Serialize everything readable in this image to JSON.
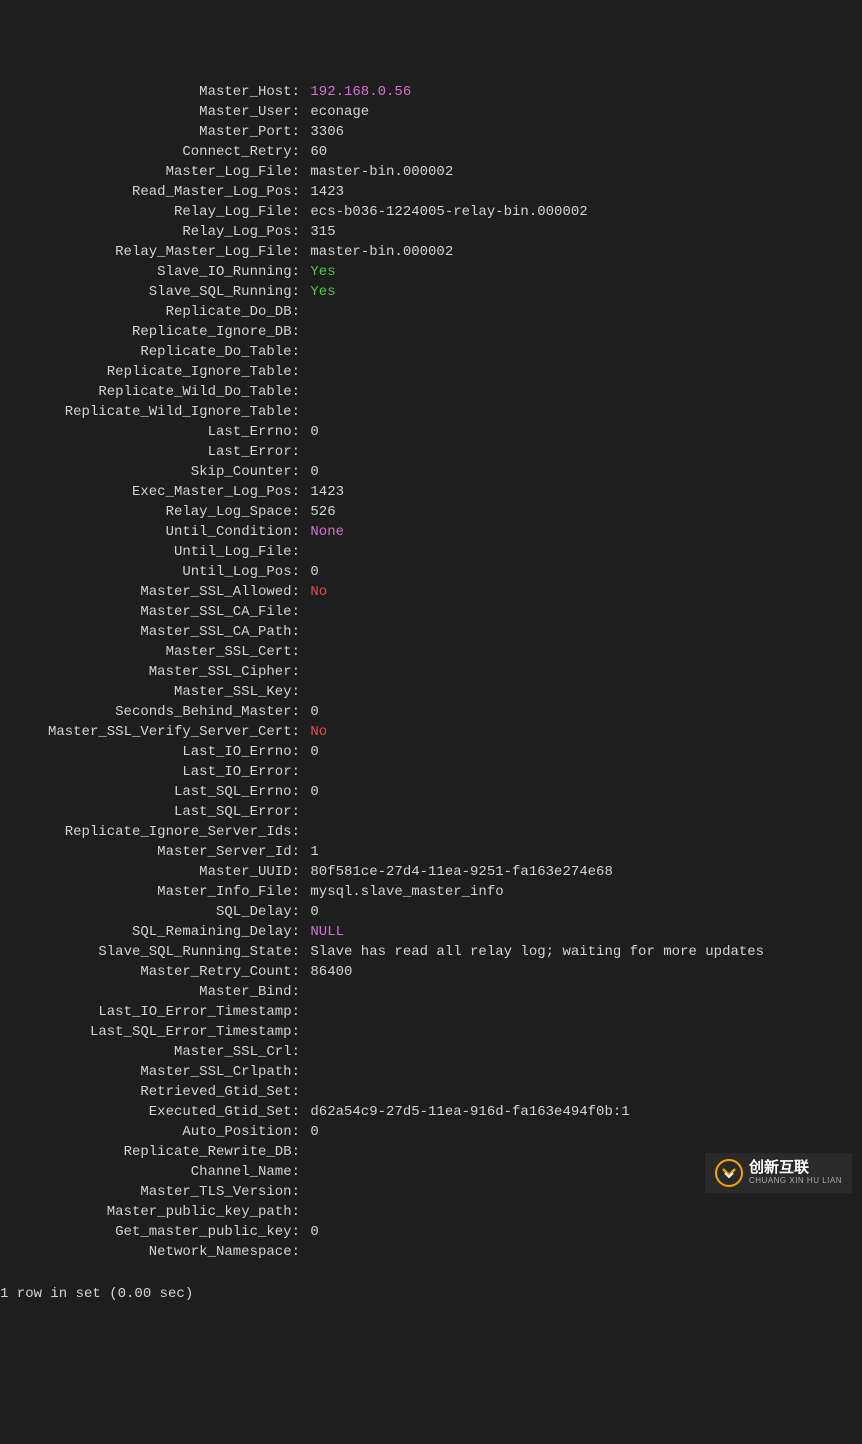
{
  "rows": [
    {
      "label": "Master_Host:",
      "value": "192.168.0.56",
      "cls": "pink"
    },
    {
      "label": "Master_User:",
      "value": "econage",
      "cls": ""
    },
    {
      "label": "Master_Port:",
      "value": "3306",
      "cls": ""
    },
    {
      "label": "Connect_Retry:",
      "value": "60",
      "cls": ""
    },
    {
      "label": "Master_Log_File:",
      "value": "master-bin.000002",
      "cls": ""
    },
    {
      "label": "Read_Master_Log_Pos:",
      "value": "1423",
      "cls": ""
    },
    {
      "label": "Relay_Log_File:",
      "value": "ecs-b036-1224005-relay-bin.000002",
      "cls": ""
    },
    {
      "label": "Relay_Log_Pos:",
      "value": "315",
      "cls": ""
    },
    {
      "label": "Relay_Master_Log_File:",
      "value": "master-bin.000002",
      "cls": ""
    },
    {
      "label": "Slave_IO_Running:",
      "value": "Yes",
      "cls": "green"
    },
    {
      "label": "Slave_SQL_Running:",
      "value": "Yes",
      "cls": "green"
    },
    {
      "label": "Replicate_Do_DB:",
      "value": "",
      "cls": ""
    },
    {
      "label": "Replicate_Ignore_DB:",
      "value": "",
      "cls": ""
    },
    {
      "label": "Replicate_Do_Table:",
      "value": "",
      "cls": ""
    },
    {
      "label": "Replicate_Ignore_Table:",
      "value": "",
      "cls": ""
    },
    {
      "label": "Replicate_Wild_Do_Table:",
      "value": "",
      "cls": ""
    },
    {
      "label": "Replicate_Wild_Ignore_Table:",
      "value": "",
      "cls": ""
    },
    {
      "label": "Last_Errno:",
      "value": "0",
      "cls": ""
    },
    {
      "label": "Last_Error:",
      "value": "",
      "cls": ""
    },
    {
      "label": "Skip_Counter:",
      "value": "0",
      "cls": ""
    },
    {
      "label": "Exec_Master_Log_Pos:",
      "value": "1423",
      "cls": ""
    },
    {
      "label": "Relay_Log_Space:",
      "value": "526",
      "cls": ""
    },
    {
      "label": "Until_Condition:",
      "value": "None",
      "cls": "pink"
    },
    {
      "label": "Until_Log_File:",
      "value": "",
      "cls": ""
    },
    {
      "label": "Until_Log_Pos:",
      "value": "0",
      "cls": ""
    },
    {
      "label": "Master_SSL_Allowed:",
      "value": "No",
      "cls": "red"
    },
    {
      "label": "Master_SSL_CA_File:",
      "value": "",
      "cls": ""
    },
    {
      "label": "Master_SSL_CA_Path:",
      "value": "",
      "cls": ""
    },
    {
      "label": "Master_SSL_Cert:",
      "value": "",
      "cls": ""
    },
    {
      "label": "Master_SSL_Cipher:",
      "value": "",
      "cls": ""
    },
    {
      "label": "Master_SSL_Key:",
      "value": "",
      "cls": ""
    },
    {
      "label": "Seconds_Behind_Master:",
      "value": "0",
      "cls": ""
    },
    {
      "label": "Master_SSL_Verify_Server_Cert:",
      "value": "No",
      "cls": "red"
    },
    {
      "label": "Last_IO_Errno:",
      "value": "0",
      "cls": ""
    },
    {
      "label": "Last_IO_Error:",
      "value": "",
      "cls": ""
    },
    {
      "label": "Last_SQL_Errno:",
      "value": "0",
      "cls": ""
    },
    {
      "label": "Last_SQL_Error:",
      "value": "",
      "cls": ""
    },
    {
      "label": "Replicate_Ignore_Server_Ids:",
      "value": "",
      "cls": ""
    },
    {
      "label": "Master_Server_Id:",
      "value": "1",
      "cls": ""
    },
    {
      "label": "Master_UUID:",
      "value": "80f581ce-27d4-11ea-9251-fa163e274e68",
      "cls": ""
    },
    {
      "label": "Master_Info_File:",
      "value": "mysql.slave_master_info",
      "cls": ""
    },
    {
      "label": "SQL_Delay:",
      "value": "0",
      "cls": ""
    },
    {
      "label": "SQL_Remaining_Delay:",
      "value": "NULL",
      "cls": "pink"
    },
    {
      "label": "Slave_SQL_Running_State:",
      "value": "Slave has read all relay log; waiting for more updates",
      "cls": ""
    },
    {
      "label": "Master_Retry_Count:",
      "value": "86400",
      "cls": ""
    },
    {
      "label": "Master_Bind:",
      "value": "",
      "cls": ""
    },
    {
      "label": "Last_IO_Error_Timestamp:",
      "value": "",
      "cls": ""
    },
    {
      "label": "Last_SQL_Error_Timestamp:",
      "value": "",
      "cls": ""
    },
    {
      "label": "Master_SSL_Crl:",
      "value": "",
      "cls": ""
    },
    {
      "label": "Master_SSL_Crlpath:",
      "value": "",
      "cls": ""
    },
    {
      "label": "Retrieved_Gtid_Set:",
      "value": "",
      "cls": ""
    },
    {
      "label": "Executed_Gtid_Set:",
      "value": "d62a54c9-27d5-11ea-916d-fa163e494f0b:1",
      "cls": ""
    },
    {
      "label": "Auto_Position:",
      "value": "0",
      "cls": ""
    },
    {
      "label": "Replicate_Rewrite_DB:",
      "value": "",
      "cls": ""
    },
    {
      "label": "Channel_Name:",
      "value": "",
      "cls": ""
    },
    {
      "label": "Master_TLS_Version:",
      "value": "",
      "cls": ""
    },
    {
      "label": "Master_public_key_path:",
      "value": "",
      "cls": ""
    },
    {
      "label": "Get_master_public_key:",
      "value": "0",
      "cls": ""
    },
    {
      "label": "Network_Namespace:",
      "value": "",
      "cls": ""
    }
  ],
  "footer": "1 row in set (0.00 sec)",
  "watermark": {
    "cn": "创新互联",
    "en": "CHUANG XIN HU LIAN"
  }
}
